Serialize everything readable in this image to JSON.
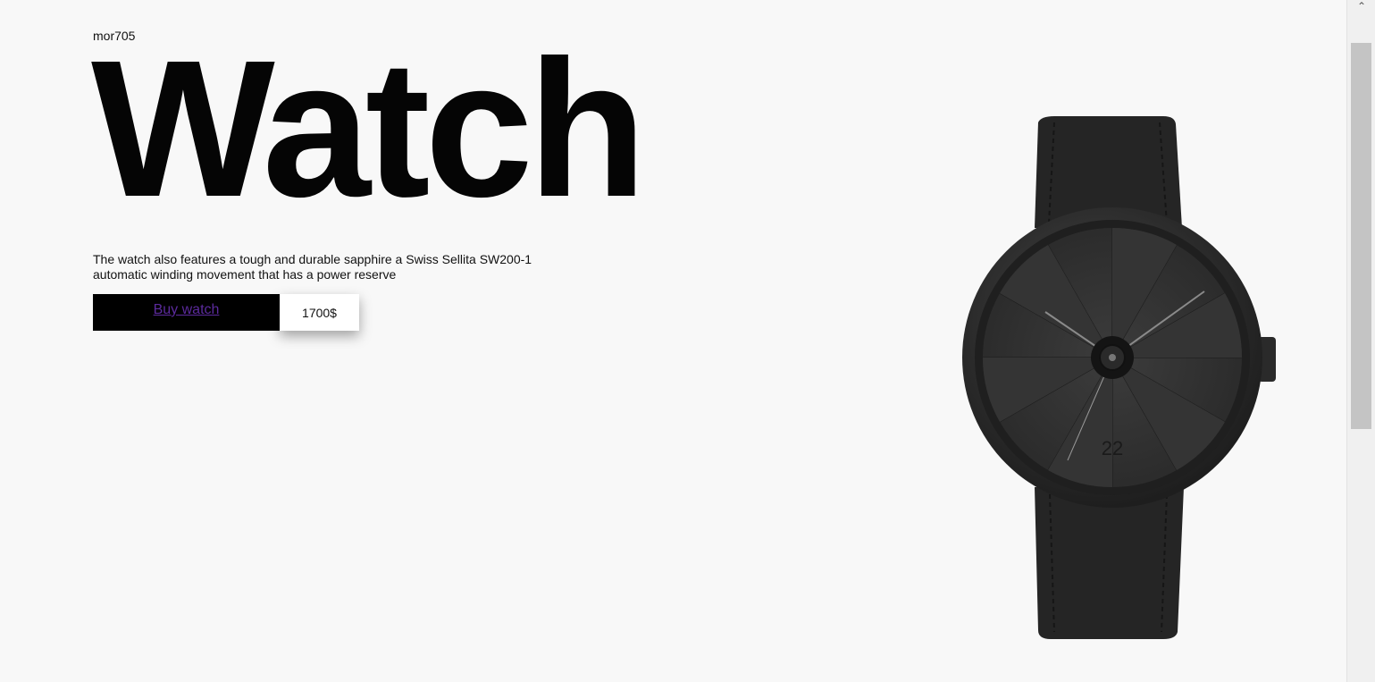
{
  "brand": "mor705",
  "hero": {
    "title": "Watch",
    "description": "The watch also features a tough and durable sapphire a Swiss Sellita SW200-1 automatic winding movement that has a power reserve"
  },
  "purchase": {
    "buy_label": "Buy watch",
    "price": "1700$"
  },
  "watch": {
    "dial_number": "22"
  },
  "colors": {
    "background": "#f8f8f8",
    "text": "#050505",
    "button_bg": "#000000",
    "link": "#5b2a9c"
  }
}
